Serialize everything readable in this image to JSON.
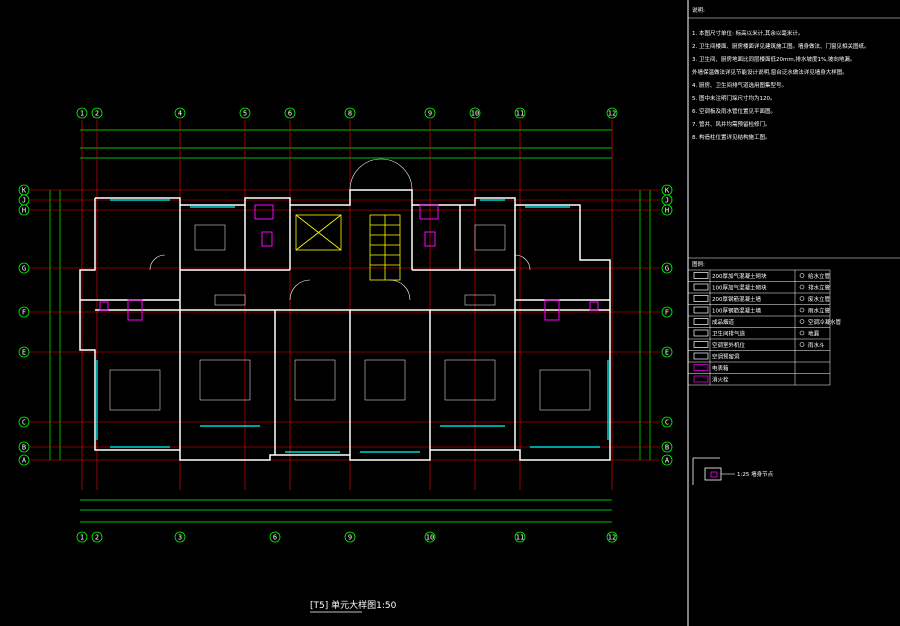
{
  "drawing": {
    "title": "[T5] 单元大样图1:50",
    "background": "#000000",
    "colors": {
      "grid": "#ff0000",
      "dim": "#00ff00",
      "wall": "#ffffff",
      "window": "#00ffff",
      "fixture": "#ff00ff",
      "stair": "#ffff00"
    }
  },
  "axes": {
    "top": [
      "1",
      "2",
      "4",
      "5",
      "6",
      "8",
      "9",
      "10",
      "11",
      "12"
    ],
    "bottom": [
      "1",
      "2",
      "3",
      "6",
      "9",
      "10",
      "11",
      "12"
    ],
    "left": [
      "K",
      "J",
      "H",
      "G",
      "F",
      "E",
      "C",
      "B",
      "A"
    ],
    "right": [
      "K",
      "J",
      "H",
      "G",
      "F",
      "E",
      "C",
      "B",
      "A"
    ]
  },
  "notes": {
    "header": "说明:",
    "lines": [
      "1. 本图尺寸单位: 标高以米计,其余以毫米计。",
      "2. 卫生间楼面、厨房楼面详见建筑施工图。墙身做法、门窗见相关图纸。",
      "3. 卫生间、厨房地面比同层楼面低20mm,排水坡度1%,坡向地漏。",
      "   外墙保温做法详见节能设计说明,窗台泛水做法详见墙身大样图。",
      "4. 厨房、卫生间排气道选用图集型号。",
      "5. 图中未注明门垛尺寸均为120。",
      "6. 空调板及雨水管位置见平面图。",
      "7. 管井、风井均需预留检修门。",
      "8. 构造柱位置详见结构施工图。"
    ]
  },
  "legend": {
    "header": "图例:",
    "rows": [
      [
        "200厚加气混凝土砌块",
        "给水立管"
      ],
      [
        "100厚加气混凝土砌块",
        "排水立管"
      ],
      [
        "200厚钢筋混凝土墙",
        "废水立管"
      ],
      [
        "100厚钢筋混凝土墙",
        "雨水立管"
      ],
      [
        "成品烟道",
        "空调冷凝水管"
      ],
      [
        "卫生间排气道",
        "地漏"
      ],
      [
        "空调室外机位",
        "雨水斗"
      ],
      [
        "空调预留洞",
        ""
      ],
      [
        "电表箱",
        ""
      ],
      [
        "消火栓",
        ""
      ]
    ]
  },
  "detail_label": "1:25 墙身节点"
}
